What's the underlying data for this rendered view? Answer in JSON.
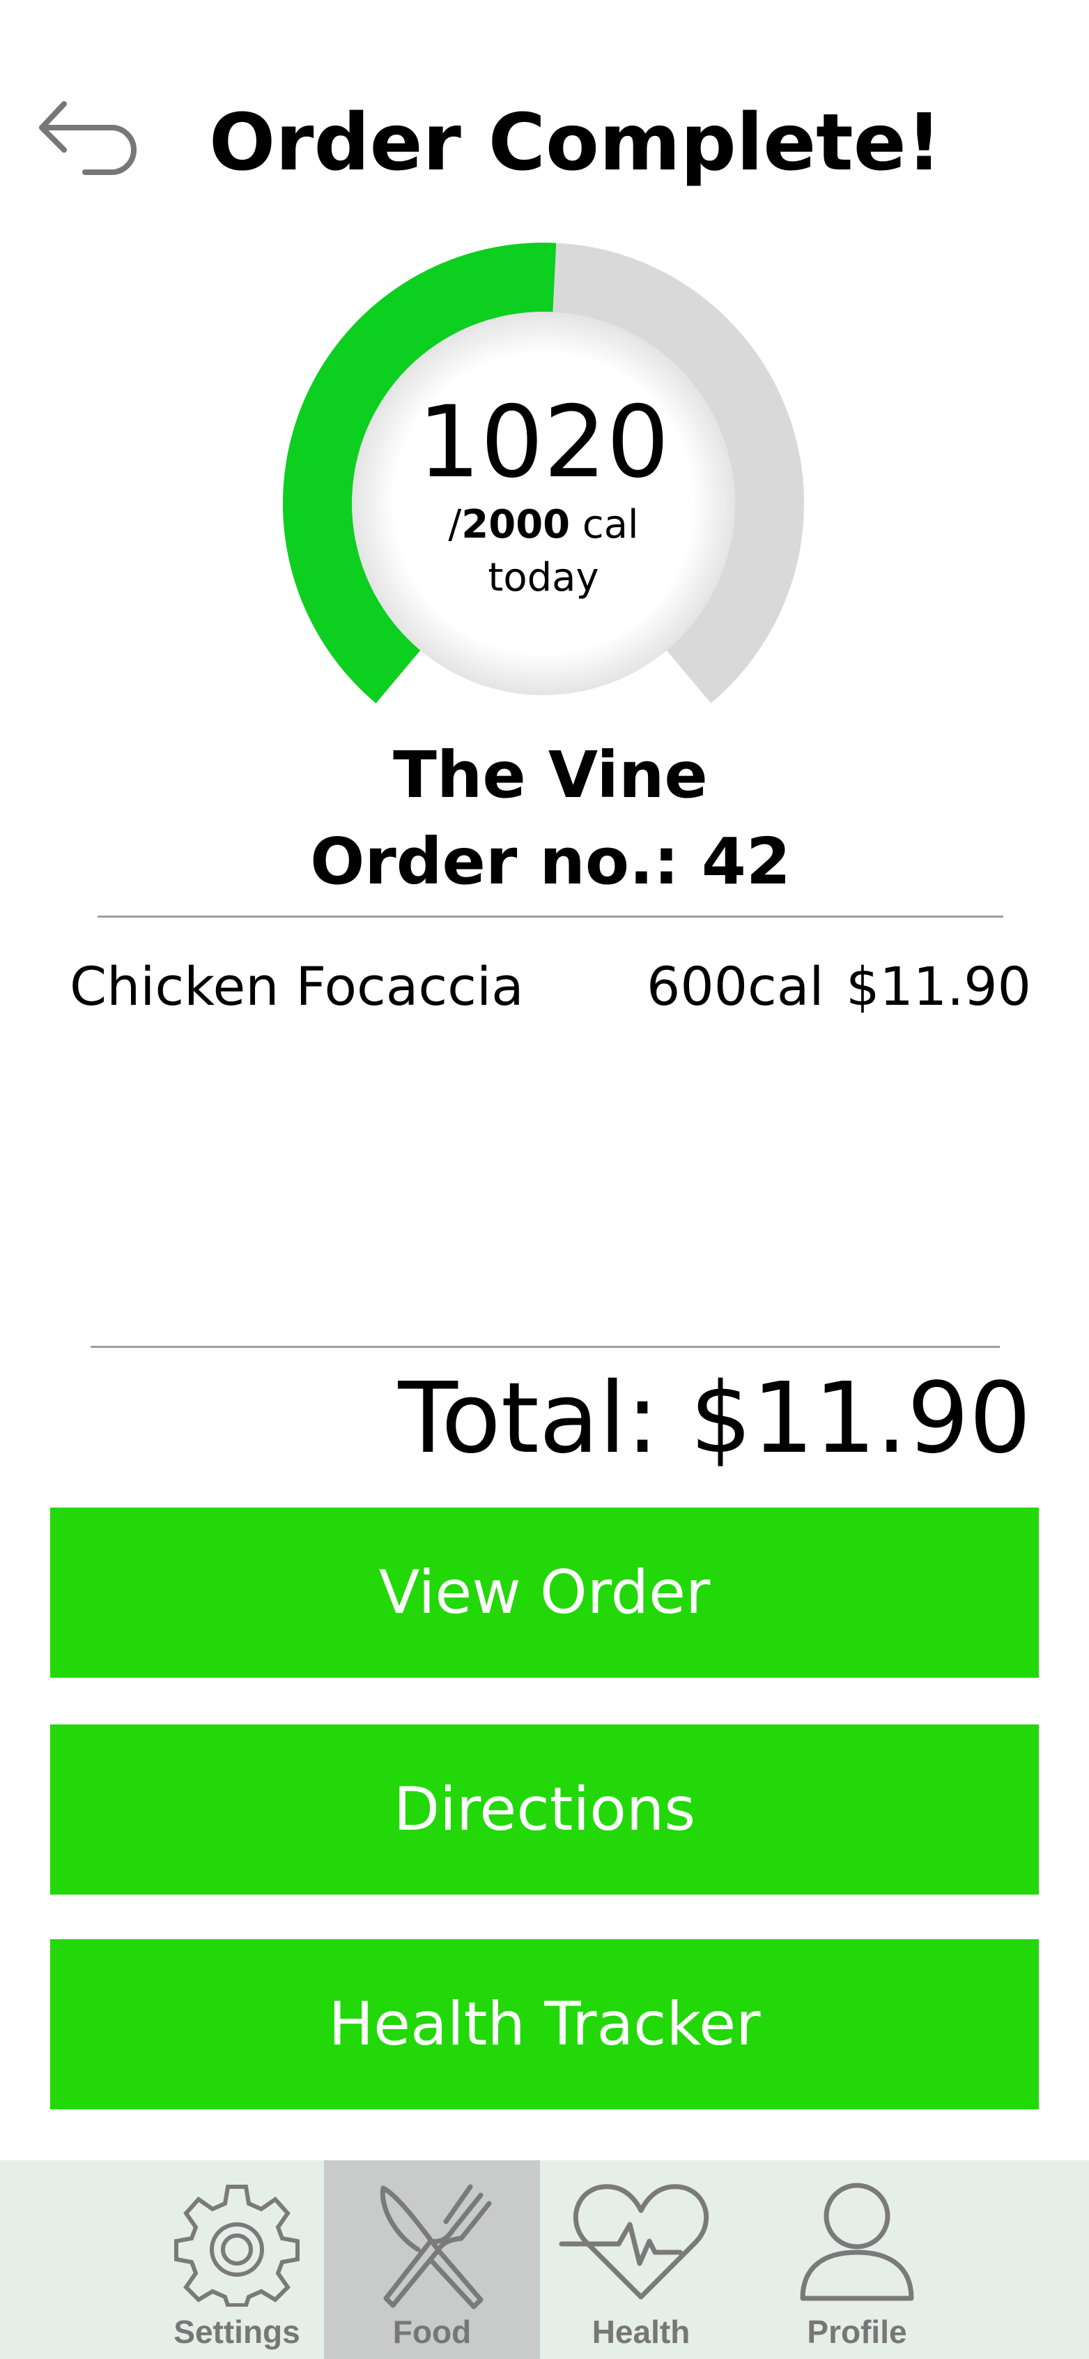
{
  "header": {
    "title": "Order Complete!"
  },
  "calorie_gauge": {
    "consumed": "1020",
    "goal_prefix": "/",
    "goal": "2000",
    "goal_unit": " cal",
    "period": "today",
    "progress_fraction": 0.51,
    "fill_color": "#0ccf20",
    "track_color": "#d9d9d9"
  },
  "order": {
    "restaurant": "The Vine",
    "order_number_text": "Order no.: 42",
    "items": [
      {
        "name": "Chicken Focaccia",
        "calories": "600cal",
        "price": "$11.90"
      }
    ],
    "total_text": "Total: $11.90"
  },
  "actions": {
    "view_order": "View Order",
    "directions": "Directions",
    "health_tracker": "Health Tracker",
    "color": "#22d808"
  },
  "bottom_nav": {
    "items": [
      {
        "label": "Settings",
        "icon": "gear-icon"
      },
      {
        "label": "Food",
        "icon": "fork-knife-icon",
        "active": true
      },
      {
        "label": "Health",
        "icon": "heart-pulse-icon"
      },
      {
        "label": "Profile",
        "icon": "person-icon"
      }
    ]
  }
}
